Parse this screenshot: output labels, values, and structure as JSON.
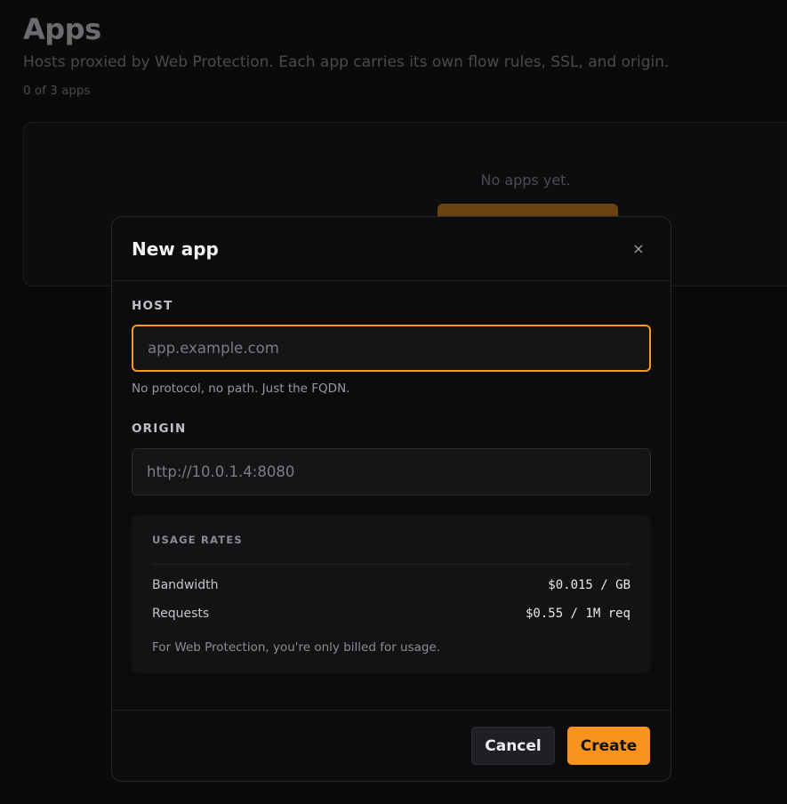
{
  "page": {
    "title": "Apps",
    "subtitle": "Hosts proxied by Web Protection. Each app carries its own flow rules, SSL, and origin.",
    "count": "0 of 3 apps",
    "empty_text": "No apps yet."
  },
  "modal": {
    "title": "New app",
    "close_glyph": "×",
    "host": {
      "label": "HOST",
      "value": "",
      "placeholder": "app.example.com",
      "help": "No protocol, no path. Just the FQDN."
    },
    "origin": {
      "label": "ORIGIN",
      "value": "",
      "placeholder": "http://10.0.1.4:8080"
    },
    "usage_rates": {
      "title": "USAGE RATES",
      "rows": [
        {
          "name": "Bandwidth",
          "value": "$0.015 / GB"
        },
        {
          "name": "Requests",
          "value": "$0.55 / 1M req"
        }
      ],
      "note": "For Web Protection, you're only billed for usage."
    },
    "buttons": {
      "cancel": "Cancel",
      "create": "Create"
    }
  },
  "colors": {
    "accent": "#f7931e",
    "focus_border": "#f59a23",
    "background": "#0a0a0b",
    "modal_bg": "#0c0c0e"
  },
  "icons": {
    "close": "close-icon"
  }
}
